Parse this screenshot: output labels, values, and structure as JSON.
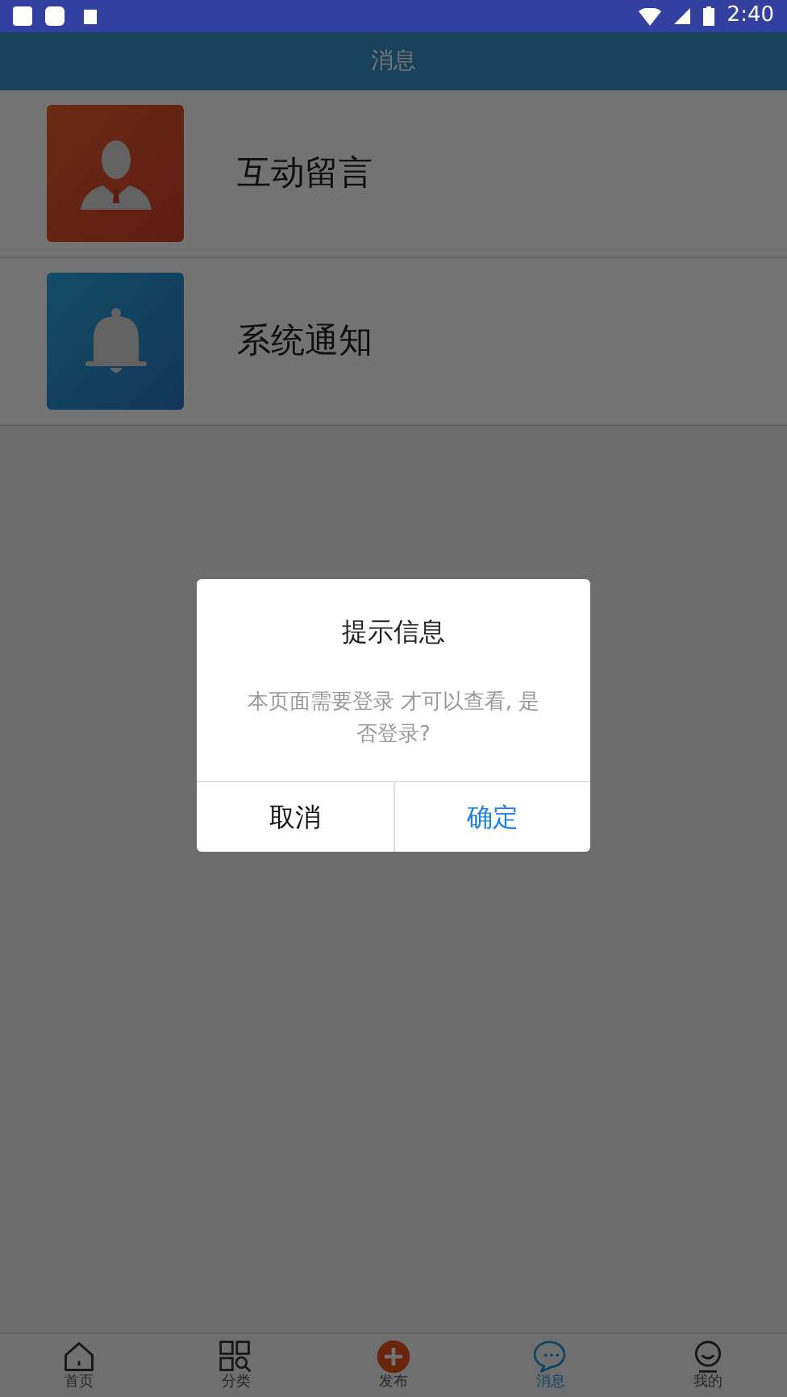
{
  "status_bar": {
    "time": "2:40"
  },
  "header": {
    "title": "消息"
  },
  "items": [
    {
      "label": "互动留言"
    },
    {
      "label": "系统通知"
    }
  ],
  "dialog": {
    "title": "提示信息",
    "message": "本页面需要登录 才可以查看, 是否登录?",
    "buttons": [
      {
        "label": "取消",
        "primary": false
      },
      {
        "label": "确定",
        "primary": true
      }
    ]
  },
  "tabs": [
    {
      "label": "首页",
      "selected": false
    },
    {
      "label": "分类",
      "selected": false
    },
    {
      "label": "发布",
      "selected": false
    },
    {
      "label": "消息",
      "selected": true
    },
    {
      "label": "我的",
      "selected": false
    }
  ]
}
